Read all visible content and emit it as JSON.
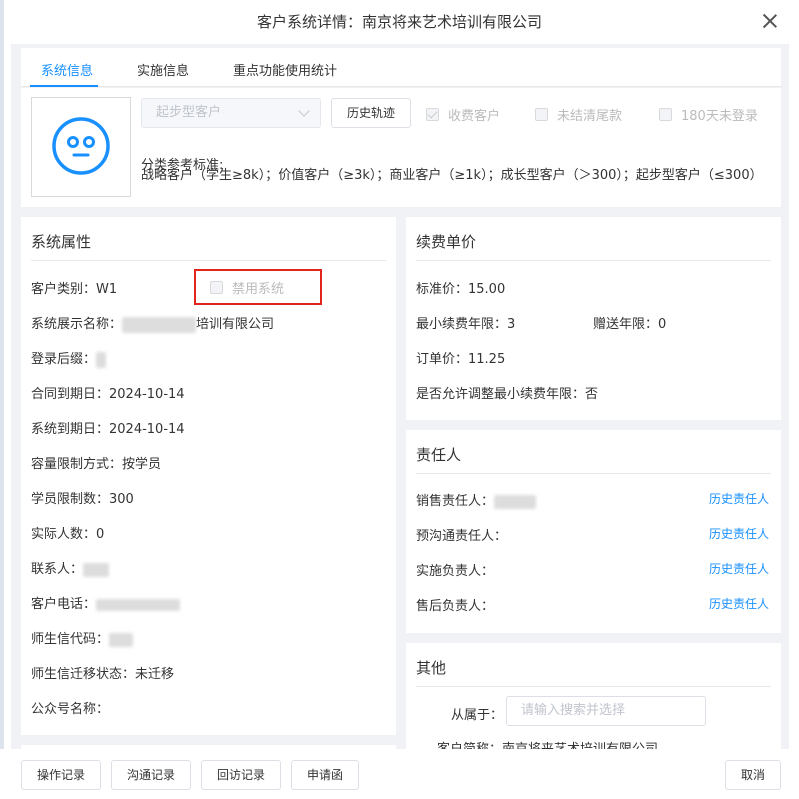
{
  "title": "客户系统详情：南京将来艺术培训有限公司",
  "tabs": [
    "系统信息",
    "实施信息",
    "重点功能使用统计"
  ],
  "top": {
    "select_value": "起步型客户",
    "history_button": "历史轨迹",
    "checkboxes": [
      {
        "label": "收费客户",
        "checked": true
      },
      {
        "label": "未结清尾款",
        "checked": false
      },
      {
        "label": "180天未登录",
        "checked": false
      }
    ],
    "standard_label": "分类参考标准:",
    "standard_text": "战略客户（学生≥8k）；价值客户（≥3k）；商业客户（≥1k）；成长型客户（＞300）；起步型客户（≤300）"
  },
  "system_props": {
    "title": "系统属性",
    "customer_type": "客户类别：W1",
    "disable_system": "禁用系统",
    "display_name_label": "系统展示名称：",
    "display_name_suffix": "培训有限公司",
    "login_suffix": "登录后缀：",
    "contract_expiry": "合同到期日：2024-10-14",
    "system_expiry": "系统到期日：2024-10-14",
    "limit_method": "容量限制方式：按学员",
    "student_limit": "学员限制数：300",
    "actual_count": "实际人数：0",
    "contact": "联系人：",
    "phone": "客户电话：",
    "code": "师生信代码：",
    "migrate_status": "师生信迁移状态：未迁移",
    "official_account": "公众号名称："
  },
  "renewal": {
    "title": "续费单价",
    "standard_price": "标准价：15.00",
    "min_years": "最小续费年限：3",
    "gift_years": "赠送年限：0",
    "order_price": "订单价：11.25",
    "allow_adjust": "是否允许调整最小续费年限：否"
  },
  "responsible": {
    "title": "责任人",
    "rows": [
      {
        "label": "销售责任人：",
        "link": "历史责任人"
      },
      {
        "label": "预沟通责任人：",
        "link": "历史责任人"
      },
      {
        "label": "实施负责人：",
        "link": "历史责任人"
      },
      {
        "label": "售后负责人：",
        "link": "历史责任人"
      }
    ]
  },
  "other": {
    "title": "其他",
    "belongs_label": "从属于：",
    "belongs_placeholder": "请输入搜索并选择",
    "short_name": "客户简称：南京将来艺术培训有限公司"
  },
  "footer": {
    "buttons": [
      "操作记录",
      "沟通记录",
      "回访记录",
      "申请函"
    ],
    "cancel": "取消"
  },
  "colors": {
    "accent": "#1890ff",
    "highlight": "#e1251b"
  }
}
